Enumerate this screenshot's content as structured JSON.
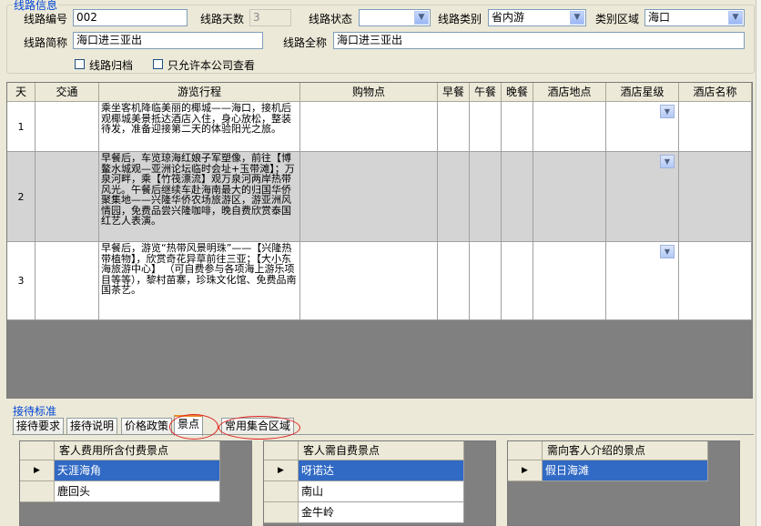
{
  "route_info": {
    "title": "线路信息",
    "route_no_label": "线路编号",
    "route_no_value": "002",
    "days_label": "线路天数",
    "days_value": "3",
    "status_label": "线路状态",
    "status_value": "",
    "category_label": "线路类别",
    "category_value": "省内游",
    "region_label": "类别区域",
    "region_value": "海口",
    "short_name_label": "线路简称",
    "short_name_value": "海口进三亚出",
    "full_name_label": "线路全称",
    "full_name_value": "海口进三亚出",
    "archive_label": "线路归档",
    "company_only_label": "只允许本公司查看"
  },
  "itinerary": {
    "columns": [
      "天",
      "交通",
      "游览行程",
      "购物点",
      "早餐",
      "午餐",
      "晚餐",
      "酒店地点",
      "酒店星级",
      "酒店名称"
    ],
    "rows": [
      {
        "day": "1",
        "desc": "乘坐客机降临美丽的椰城——海口，接机后观椰城美景抵达酒店入住，身心放松，整装待发，准备迎接第二天的体验阳光之旅。"
      },
      {
        "day": "2",
        "desc": "早餐后，车览琼海红娘子军塑像，前往【博鳌水城观—亚洲论坛临时会址+玉带滩】；万泉河畔，乘【竹筏漂流】观万泉河两岸热带风光。午餐后继续车赴海南最大的归国华侨聚集地——兴隆华侨农场旅游区，游亚洲风情园，免费品尝兴隆咖啡，晚自费欣赏泰国红艺人表演。"
      },
      {
        "day": "3",
        "desc": "早餐后，游览“热带风景明珠”——【兴隆热带植物】，欣赏奇花异草前往三亚；【大小东海旅游中心】 （可自费参与各项海上游乐项目等等），黎村苗寨，珍珠文化馆、免费品南国茶艺。"
      }
    ]
  },
  "reception": {
    "title": "接待标准",
    "tabs": [
      "接待要求",
      "接待说明",
      "价格政策",
      "景点",
      "常用集合区域"
    ],
    "active_tab": "景点"
  },
  "spots": {
    "included": {
      "header": "客人费用所含付费景点",
      "items": [
        "天涯海角",
        "鹿回头"
      ]
    },
    "self_paid": {
      "header": "客人需自费景点",
      "items": [
        "呀诺达",
        "南山",
        "金牛岭"
      ]
    },
    "introduce": {
      "header": "需向客人介绍的景点",
      "items": [
        "假日海滩"
      ]
    }
  },
  "icons": {
    "dropdown": "chevron-down-icon",
    "row_pointer": "row-pointer-icon"
  },
  "colors": {
    "selection": "#316ac5",
    "group_title": "#0046d5",
    "annotation": "#e02020"
  }
}
